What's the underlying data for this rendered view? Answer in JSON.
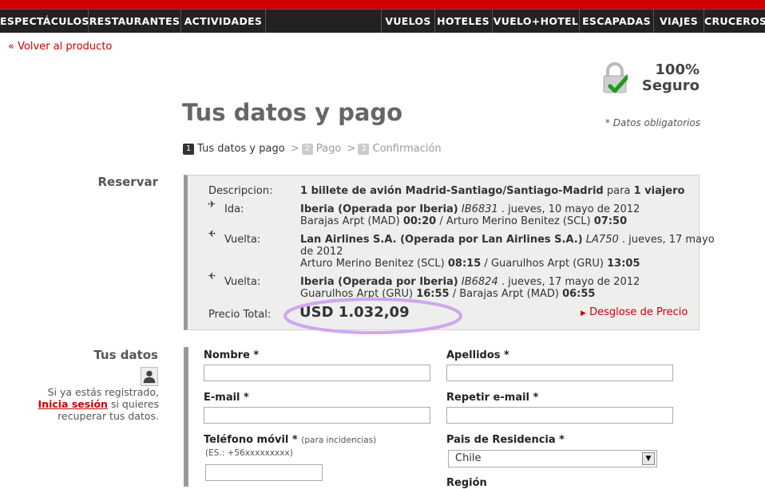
{
  "nav": {
    "left": [
      "ESPECTÁCULOS",
      "RESTAURANTES",
      "ACTIVIDADES"
    ],
    "right": [
      "VUELOS",
      "HOTELES",
      "VUELO+HOTEL",
      "ESCAPADAS",
      "VIAJES",
      "CRUCEROS"
    ]
  },
  "back_link": "« Volver al producto",
  "secure": {
    "percent": "100%",
    "word": "Seguro"
  },
  "page_title": "Tus datos y pago",
  "mandatory_note": "* Datos obligatorios",
  "steps": [
    {
      "num": "1",
      "label": "Tus datos y pago",
      "active": true
    },
    {
      "num": "2",
      "label": "Pago",
      "active": false
    },
    {
      "num": "3",
      "label": "Confirmación",
      "active": false
    }
  ],
  "step_separator": ">",
  "reservar": {
    "section_label": "Reservar",
    "desc_label": "Descripcion:",
    "desc_bold": "1 billete de avión Madrid-Santiago/Santiago-Madrid",
    "desc_mid": "para",
    "desc_pax": "1 viajero",
    "flights": [
      {
        "label": "Ida:",
        "airline": "Iberia (Operada por Iberia)",
        "code": "IB6831",
        "date": ". jueves, 10 mayo de 2012",
        "from": "Barajas Arpt (MAD)",
        "dep": "00:20",
        "to": "Arturo Merino Benitez (SCL)",
        "arr": "07:50"
      },
      {
        "label": "Vuelta:",
        "airline": "Lan Airlines S.A. (Operada por Lan Airlines S.A.)",
        "code": "LA750",
        "date": ". jueves, 17 mayo",
        "date2": "de 2012",
        "from": "Arturo Merino Benitez (SCL)",
        "dep": "08:15",
        "to": "Guarulhos Arpt (GRU)",
        "arr": "13:05"
      },
      {
        "label": "Vuelta:",
        "airline": "Iberia (Operada por Iberia)",
        "code": "IB6824",
        "date": ". jueves, 17 mayo de 2012",
        "from": "Guarulhos Arpt (GRU)",
        "dep": "16:55",
        "to": "Barajas Arpt (MAD)",
        "arr": "06:55"
      }
    ],
    "total_label": "Precio Total:",
    "total_value": "USD 1.032,09",
    "breakdown_link": "Desglose de Precio"
  },
  "tus_datos": {
    "section_label": "Tus datos",
    "register_line1": "Si ya estás registrado,",
    "login_link": "Inicia sesión",
    "register_line2": "si quieres",
    "register_line3": "recuperar tus datos."
  },
  "form": {
    "nombre": "Nombre *",
    "apellidos": "Apellidos *",
    "email": "E-mail *",
    "email_repeat": "Repetir e-mail *",
    "telefono": "Teléfono móvil *",
    "telefono_hint": "(para incidencias)",
    "telefono_example": "(ES.: +56xxxxxxxxx)",
    "pais": "Pais de Residencia *",
    "pais_value": "Chile",
    "region": "Región"
  }
}
